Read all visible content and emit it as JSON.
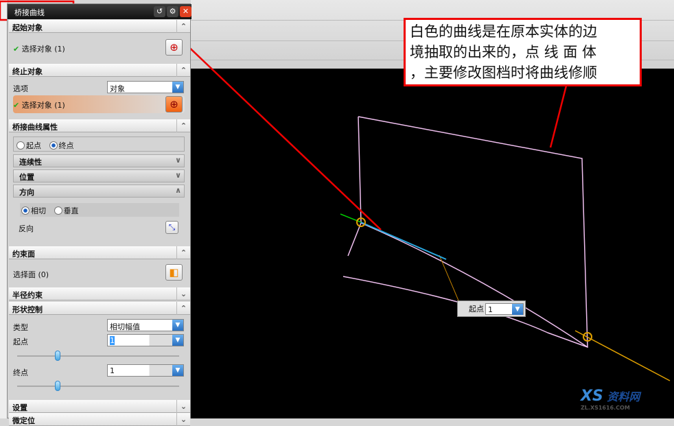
{
  "dialog": {
    "title": "桥接曲线",
    "title_buttons": [
      "reset",
      "settings",
      "close"
    ],
    "start_object": {
      "header": "起始对象",
      "select_label": "选择对象 (1)"
    },
    "end_object": {
      "header": "终止对象",
      "option_label": "选项",
      "option_value": "对象",
      "select_label": "选择对象 (1)"
    },
    "properties": {
      "header": "桥接曲线属性",
      "radio_start": "起点",
      "radio_end": "终点",
      "selected": "终点",
      "continuity": "连续性",
      "position": "位置",
      "direction": "方向",
      "dir_tangent": "相切",
      "dir_normal": "垂直",
      "dir_selected": "相切",
      "reverse": "反向"
    },
    "constraint_face": {
      "header": "约束面",
      "select_label": "选择面 (0)"
    },
    "radius_constraint": {
      "header": "半径约束"
    },
    "shape_control": {
      "header": "形状控制",
      "type_label": "类型",
      "type_value": "相切幅值",
      "start_label": "起点",
      "start_value": "1",
      "start_slider": 0.25,
      "end_label": "终点",
      "end_value": "1",
      "end_slider": 0.25
    },
    "settings": {
      "header": "设置"
    },
    "micro_position": {
      "header": "微定位"
    }
  },
  "annotation": {
    "line1": "白色的曲线是在原本实体的边",
    "line2": "境抽取的出来的，点 线 面 体",
    "line3": "，主要修改图档时将曲线修顺"
  },
  "viewport": {
    "handle_label": "起点",
    "handle_value": "1",
    "curve_color": "#f0c0f0",
    "annotation_color": "#ee0000",
    "tangent_color": "#29a8e0",
    "orange_vector": "#e0a000"
  },
  "watermark": {
    "logo_text": "XS",
    "site": "资料网",
    "url": "ZL.XS1616.COM"
  }
}
